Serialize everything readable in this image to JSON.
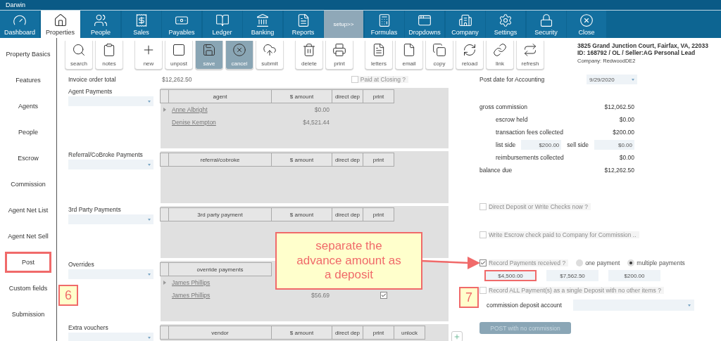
{
  "window": {
    "title": "Darwin"
  },
  "nav_tabs": [
    {
      "label": "Dashboard",
      "selected": false,
      "kind": "module"
    },
    {
      "label": "Properties",
      "selected": true,
      "kind": "module"
    },
    {
      "label": "People",
      "selected": false,
      "kind": "module"
    },
    {
      "label": "Sales",
      "selected": false,
      "kind": "module"
    },
    {
      "label": "Payables",
      "selected": false,
      "kind": "module"
    },
    {
      "label": "Ledger",
      "selected": false,
      "kind": "module"
    },
    {
      "label": "Banking",
      "selected": false,
      "kind": "module"
    },
    {
      "label": "Reports",
      "selected": false,
      "kind": "module"
    },
    {
      "label": "setup>>",
      "selected": false,
      "kind": "expander"
    },
    {
      "label": "Formulas",
      "selected": false,
      "kind": "module"
    },
    {
      "label": "Dropdowns",
      "selected": false,
      "kind": "module"
    },
    {
      "label": "Company",
      "selected": false,
      "kind": "module"
    },
    {
      "label": "Settings",
      "selected": false,
      "kind": "module"
    },
    {
      "label": "Security",
      "selected": false,
      "kind": "module"
    },
    {
      "label": "Close",
      "selected": false,
      "kind": "module"
    }
  ],
  "sidebar": {
    "items": [
      {
        "label": "Property Basics",
        "highlighted": false
      },
      {
        "label": "Features",
        "highlighted": false
      },
      {
        "label": "Agents",
        "highlighted": false
      },
      {
        "label": "People",
        "highlighted": false
      },
      {
        "label": "Escrow",
        "highlighted": false
      },
      {
        "label": "Commission",
        "highlighted": false
      },
      {
        "label": "Agent Net List",
        "highlighted": false
      },
      {
        "label": "Agent Net Sell",
        "highlighted": false
      },
      {
        "label": "Post",
        "highlighted": true
      },
      {
        "label": "Custom fields",
        "highlighted": false
      },
      {
        "label": "Submission",
        "highlighted": false
      }
    ]
  },
  "toolbar": {
    "groups": [
      {
        "buttons": [
          {
            "label": "search",
            "pressed": false
          },
          {
            "label": "notes",
            "pressed": false
          }
        ]
      },
      {
        "buttons": [
          {
            "label": "new",
            "pressed": false
          },
          {
            "label": "unpost",
            "pressed": false
          },
          {
            "label": "save",
            "pressed": true
          },
          {
            "label": "cancel",
            "pressed": true
          },
          {
            "label": "submit",
            "pressed": false
          }
        ]
      },
      {
        "buttons": [
          {
            "label": "delete",
            "pressed": false
          },
          {
            "label": "print",
            "pressed": false
          }
        ]
      },
      {
        "buttons": [
          {
            "label": "letters",
            "pressed": false
          },
          {
            "label": "email",
            "pressed": false
          },
          {
            "label": "copy",
            "pressed": false
          },
          {
            "label": "reload",
            "pressed": false
          },
          {
            "label": "link",
            "pressed": false
          },
          {
            "label": "refresh",
            "pressed": false
          }
        ]
      }
    ]
  },
  "header": {
    "address": "3825 Grand Junction Court, Fairfax, VA, 22033",
    "id_line": "ID:  168792 / OL / Seller:AG Personal Lead",
    "company": "Company: RedwoodDE2"
  },
  "invoice_total": {
    "label": "Invoice order total",
    "value": "$12,262.50"
  },
  "paid_at_closing": {
    "label": "Paid at Closing ?",
    "checked": false
  },
  "sections": [
    {
      "label": "Agent Payments",
      "columns": [
        "agent",
        "$ amount",
        "direct dep",
        "print"
      ],
      "rows": [
        {
          "name": "Anne Albright",
          "amount": "$0.00",
          "expandable": true
        },
        {
          "name": "Denise Kempton",
          "amount": "$4,521.44",
          "expandable": false
        }
      ]
    },
    {
      "label": "Referral/CoBroke Payments",
      "columns": [
        "referral/cobroke",
        "$ amount",
        "direct dep",
        "print"
      ]
    },
    {
      "label": "3rd Party Payments",
      "columns": [
        "3rd party payment",
        "$ amount",
        "direct dep",
        "print"
      ]
    },
    {
      "label": "Overrides",
      "columns": [
        "override payments"
      ],
      "rows": [
        {
          "name": "James Phillips",
          "expandable": true
        },
        {
          "name": "James Phillips",
          "amount": "$56.69",
          "expandable": false,
          "print_checked": true
        }
      ]
    },
    {
      "label": "Extra vouchers",
      "columns": [
        "vendor",
        "$ amount",
        "direct dep",
        "print",
        "unlock"
      ]
    }
  ],
  "posting": {
    "post_date": {
      "label": "Post date for Accounting",
      "value": "9/29/2020"
    },
    "summary": [
      {
        "kind": "line",
        "label": "gross commission",
        "value": "$12,062.50",
        "children": [
          {
            "kind": "line",
            "label": "escrow held",
            "value": "$0.00"
          },
          {
            "kind": "line",
            "label": "transaction fees collected",
            "value": "$200.00"
          },
          {
            "kind": "split",
            "label": "list side",
            "value": "$200.00",
            "label_2": "sell side",
            "value_2": "$0.00"
          },
          {
            "kind": "line",
            "label": "reimbursements collected",
            "value": "$0.00"
          }
        ]
      },
      {
        "kind": "line",
        "label": "balance due",
        "value": "$12,262.50"
      }
    ],
    "direct_deposit": {
      "label": "Direct Deposit  or  Write Checks now  ?",
      "checked": false
    },
    "escrow_check": {
      "label": "Write Escrow check paid to Company for Commission ..",
      "checked": false
    },
    "record_payments": {
      "label": "Record Payments received ?",
      "checked": true
    },
    "payment_mode": [
      {
        "label": "one payment",
        "selected": false
      },
      {
        "label": "multiple payments",
        "selected": true
      }
    ],
    "payment_amounts": [
      {
        "value": "$4,500.00",
        "highlighted": true
      },
      {
        "value": "$7,562.50",
        "highlighted": false
      },
      {
        "value": "$200.00",
        "highlighted": false
      }
    ],
    "single_deposit": {
      "label": "Record ALL Payment(s) as a single Deposit with no other items ?",
      "checked": false
    },
    "deposit_account": {
      "label": "commission deposit account"
    },
    "post_button": {
      "label": "POST with no commission",
      "disabled": true
    }
  },
  "annotations": {
    "callout": "separate the advance amount as a deposit",
    "step_badges": [
      "6",
      "7"
    ]
  }
}
